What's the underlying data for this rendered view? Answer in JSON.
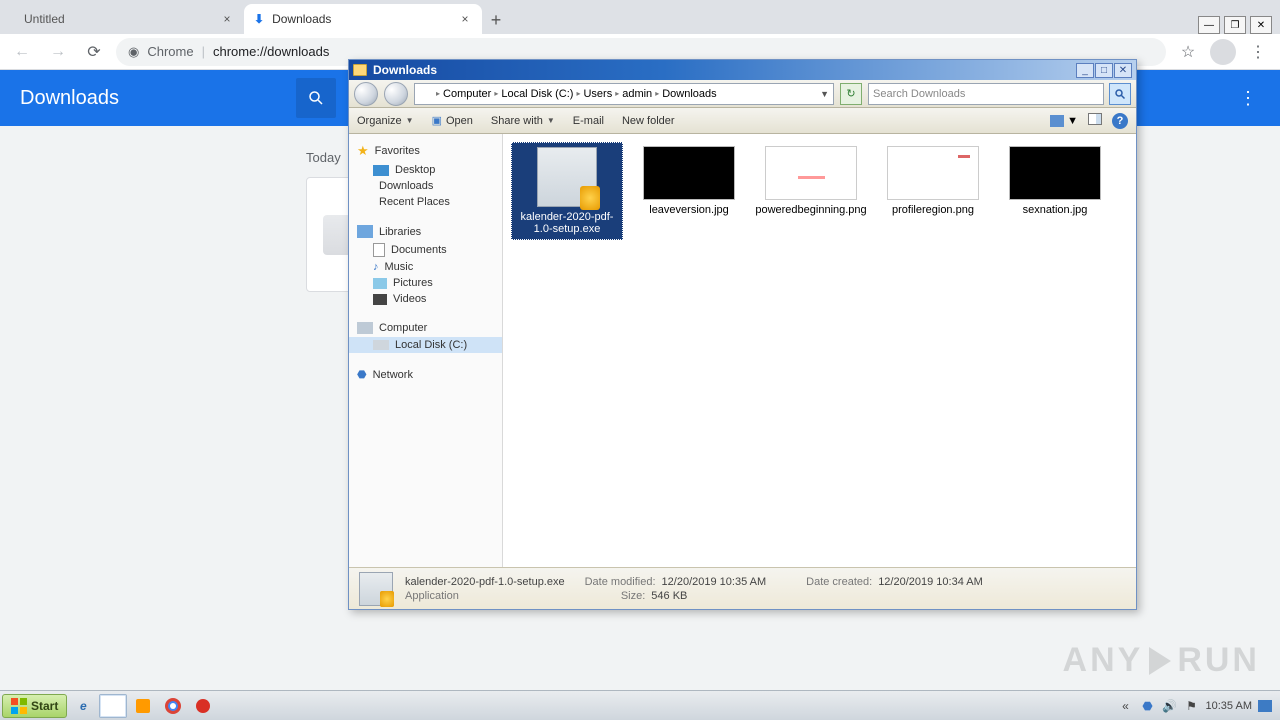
{
  "chrome": {
    "tabs": [
      {
        "label": "Untitled",
        "active": false
      },
      {
        "label": "Downloads",
        "active": true
      }
    ],
    "omnibox": {
      "scheme_label": "Chrome",
      "url_text": "chrome://downloads"
    },
    "page": {
      "title": "Downloads",
      "section_label": "Today"
    }
  },
  "explorer": {
    "title": "Downloads",
    "breadcrumbs": [
      "Computer",
      "Local Disk (C:)",
      "Users",
      "admin",
      "Downloads"
    ],
    "search_placeholder": "Search Downloads",
    "toolbar": {
      "organize": "Organize",
      "open": "Open",
      "share": "Share with",
      "email": "E-mail",
      "new_folder": "New folder"
    },
    "nav": {
      "favorites": {
        "label": "Favorites",
        "items": [
          "Desktop",
          "Downloads",
          "Recent Places"
        ]
      },
      "libraries": {
        "label": "Libraries",
        "items": [
          "Documents",
          "Music",
          "Pictures",
          "Videos"
        ]
      },
      "computer": {
        "label": "Computer",
        "items": [
          "Local Disk (C:)"
        ]
      },
      "network": {
        "label": "Network"
      }
    },
    "files": [
      {
        "name": "kalender-2020-pdf-1.0-setup.exe",
        "kind": "installer",
        "selected": true
      },
      {
        "name": "leaveversion.jpg",
        "kind": "black"
      },
      {
        "name": "poweredbeginning.png",
        "kind": "pink"
      },
      {
        "name": "profileregion.png",
        "kind": "whiteacc"
      },
      {
        "name": "sexnation.jpg",
        "kind": "black"
      }
    ],
    "details": {
      "name": "kalender-2020-pdf-1.0-setup.exe",
      "type": "Application",
      "date_modified_label": "Date modified:",
      "date_modified": "12/20/2019 10:35 AM",
      "size_label": "Size:",
      "size": "546 KB",
      "date_created_label": "Date created:",
      "date_created": "12/20/2019 10:34 AM"
    }
  },
  "taskbar": {
    "start": "Start",
    "clock": "10:35 AM"
  },
  "watermark": {
    "a": "ANY",
    "b": "RUN"
  }
}
